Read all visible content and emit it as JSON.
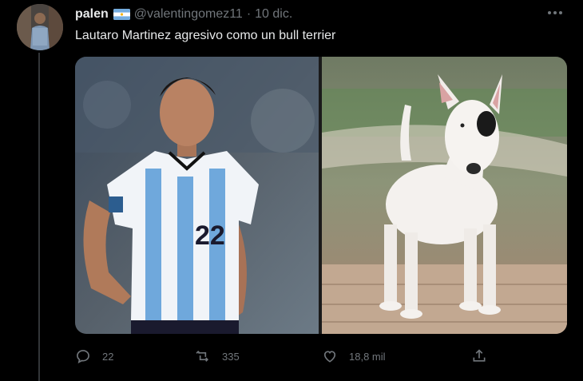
{
  "tweet": {
    "display_name": "palen",
    "handle": "@valentingomez11",
    "separator": "·",
    "date": "10 dic.",
    "text": "Lautaro Martinez agresivo como un bull terrier",
    "flag_icon": "argentina-flag-icon",
    "jersey_number": "22"
  },
  "actions": {
    "replies": "22",
    "retweets": "335",
    "likes": "18,8 mil"
  },
  "colors": {
    "background": "#000000",
    "primary_text": "#e7e9ea",
    "secondary_text": "#71767b",
    "divider": "#333639"
  }
}
